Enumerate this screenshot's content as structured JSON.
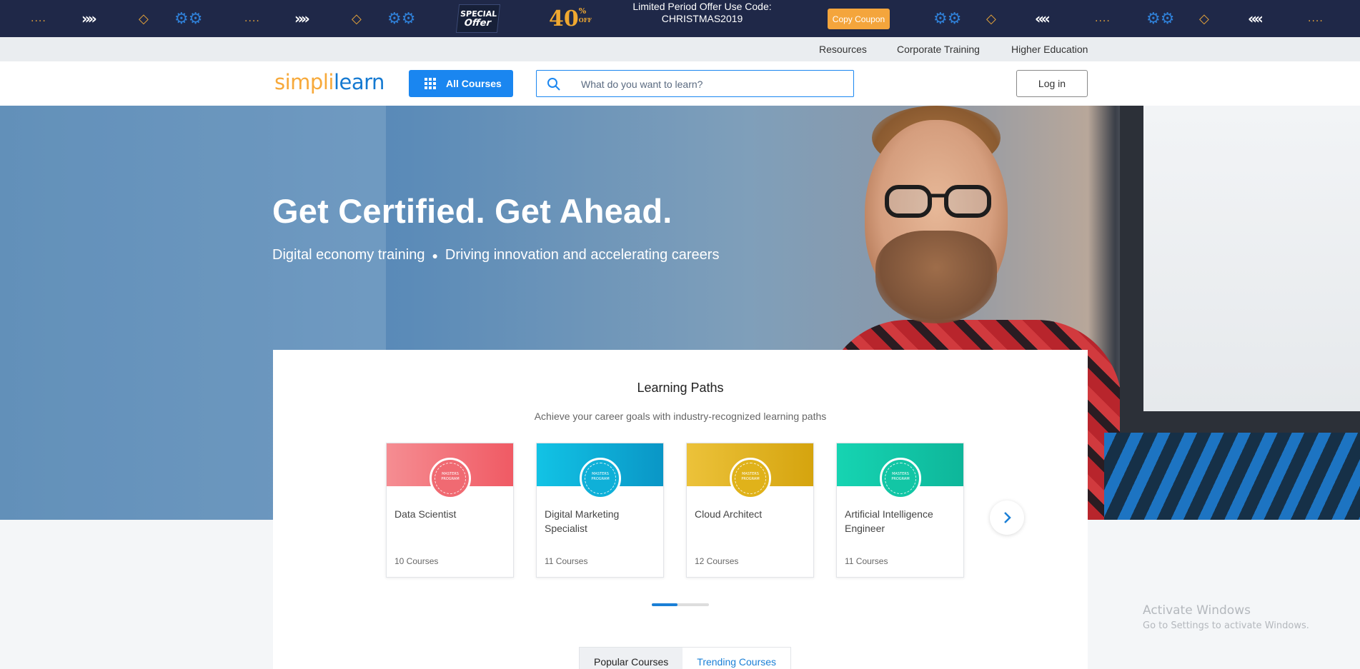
{
  "promo": {
    "special_line1": "SPECIAL",
    "special_line2": "Offer",
    "percent": "40",
    "percent_sign": "%",
    "percent_off": "OFF",
    "offer_line1": "Limited Period Offer Use Code:",
    "offer_code": "CHRISTMAS2019",
    "copy_button": "Copy Coupon",
    "deco": {
      "dash": "....",
      "chevrons_right": "»»",
      "chevrons_left": "««",
      "diamond": "◇",
      "gear": "⚙⚙"
    },
    "colors": {
      "background": "#1f2848",
      "accent": "#f4a53c"
    }
  },
  "top_links": [
    "Resources",
    "Corporate Training",
    "Higher Education"
  ],
  "header": {
    "logo_part1": "simpl",
    "logo_part2": "i",
    "logo_part3": "learn",
    "all_courses": "All Courses",
    "search_placeholder": "What do you want to learn?",
    "login": "Log in",
    "colors": {
      "primary": "#1a86f0",
      "logo_orange": "#f7a93a",
      "logo_blue": "#1479d1"
    }
  },
  "hero": {
    "headline": "Get Certified. Get Ahead.",
    "subtitle_part1": "Digital economy training",
    "subtitle_part2": "Driving innovation and accelerating careers"
  },
  "learning_paths": {
    "title": "Learning Paths",
    "subtitle": "Achieve your career goals with industry-recognized learning paths",
    "badge_text": "MASTERS PROGRAM",
    "cards": [
      {
        "name": "Data Scientist",
        "count": "10 Courses",
        "color": "#f06a72"
      },
      {
        "name": "Digital Marketing Specialist",
        "count": "11 Courses",
        "color": "#0fb0d8"
      },
      {
        "name": "Cloud Architect",
        "count": "12 Courses",
        "color": "#e0b21a"
      },
      {
        "name": "Artificial Intelligence Engineer",
        "count": "11 Courses",
        "color": "#12c6a5"
      }
    ],
    "next_icon": "›"
  },
  "course_tabs": {
    "popular": "Popular Courses",
    "trending": "Trending Courses"
  },
  "watermark": {
    "line1": "Activate Windows",
    "line2": "Go to Settings to activate Windows."
  }
}
